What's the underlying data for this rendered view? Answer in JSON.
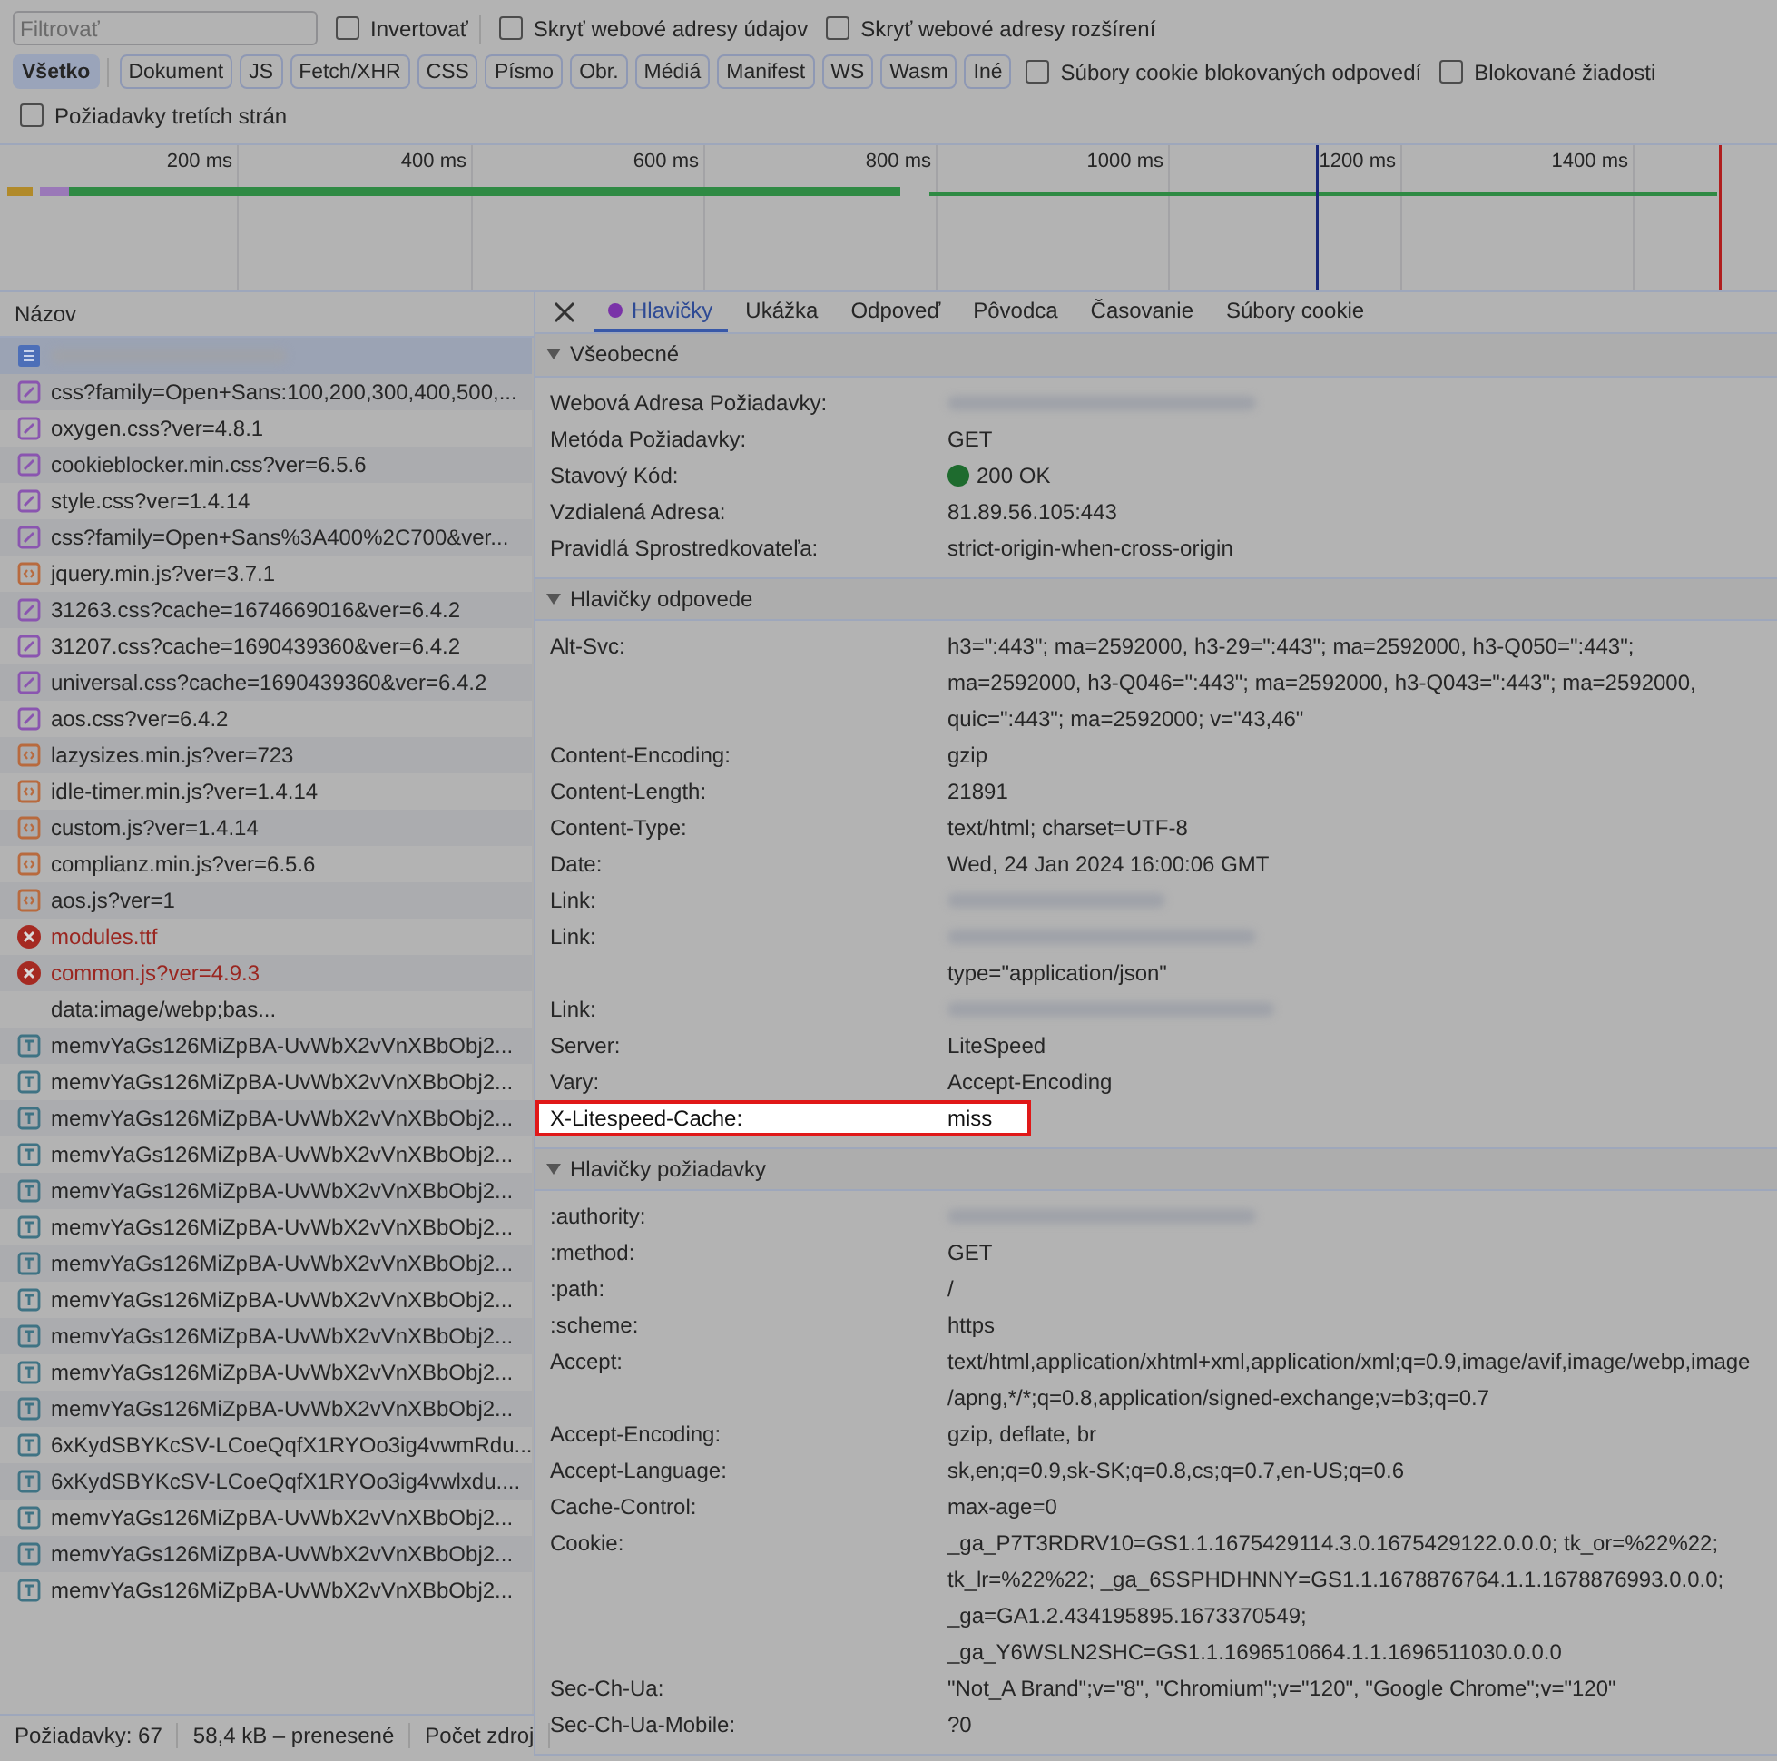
{
  "toolbar": {
    "filter": {
      "placeholder": "Filtrovať"
    },
    "checkboxes": [
      {
        "label": "Invertovať",
        "checked": false
      },
      {
        "label": "Skryť webové adresy údajov",
        "checked": false
      },
      {
        "label": "Skryť webové adresy rozšírení",
        "checked": false
      }
    ],
    "type_filters": [
      {
        "label": "Všetko",
        "selected": true
      },
      {
        "label": "Dokument",
        "selected": false
      },
      {
        "label": "JS",
        "selected": false
      },
      {
        "label": "Fetch/XHR",
        "selected": false
      },
      {
        "label": "CSS",
        "selected": false
      },
      {
        "label": "Písmo",
        "selected": false
      },
      {
        "label": "Obr.",
        "selected": false
      },
      {
        "label": "Médiá",
        "selected": false
      },
      {
        "label": "Manifest",
        "selected": false
      },
      {
        "label": "WS",
        "selected": false
      },
      {
        "label": "Wasm",
        "selected": false
      },
      {
        "label": "Iné",
        "selected": false
      }
    ],
    "filter_checkboxes": [
      {
        "label": "Súbory cookie blokovaných odpovedí",
        "checked": false
      },
      {
        "label": "Blokované žiadosti",
        "checked": false
      }
    ],
    "third_party": {
      "label": "Požiadavky tretích strán",
      "checked": false
    }
  },
  "timeline": {
    "ticks": [
      "200 ms",
      "400 ms",
      "600 ms",
      "800 ms",
      "1000 ms",
      "1200 ms",
      "1400 ms"
    ]
  },
  "requests": {
    "column": "Názov",
    "items": [
      {
        "kind": "doc",
        "selected": true
      },
      {
        "kind": "css",
        "name": "css?family=Open+Sans:100,200,300,400,500,...",
        "selected": false
      },
      {
        "kind": "css",
        "name": "oxygen.css?ver=4.8.1",
        "selected": false
      },
      {
        "kind": "css",
        "name": "cookieblocker.min.css?ver=6.5.6",
        "selected": false
      },
      {
        "kind": "css",
        "name": "style.css?ver=1.4.14",
        "selected": false
      },
      {
        "kind": "css",
        "name": "css?family=Open+Sans%3A400%2C700&ver...",
        "selected": false
      },
      {
        "kind": "js",
        "name": "jquery.min.js?ver=3.7.1",
        "selected": false
      },
      {
        "kind": "css",
        "name": "31263.css?cache=1674669016&ver=6.4.2",
        "selected": false
      },
      {
        "kind": "css",
        "name": "31207.css?cache=1690439360&ver=6.4.2",
        "selected": false
      },
      {
        "kind": "css",
        "name": "universal.css?cache=1690439360&ver=6.4.2",
        "selected": false
      },
      {
        "kind": "css",
        "name": "aos.css?ver=6.4.2",
        "selected": false
      },
      {
        "kind": "js",
        "name": "lazysizes.min.js?ver=723",
        "selected": false
      },
      {
        "kind": "js",
        "name": "idle-timer.min.js?ver=1.4.14",
        "selected": false
      },
      {
        "kind": "js",
        "name": "custom.js?ver=1.4.14",
        "selected": false
      },
      {
        "kind": "js",
        "name": "complianz.min.js?ver=6.5.6",
        "selected": false
      },
      {
        "kind": "js",
        "name": "aos.js?ver=1",
        "selected": false
      },
      {
        "kind": "error",
        "name": "modules.ttf",
        "selected": false
      },
      {
        "kind": "error",
        "name": "common.js?ver=4.9.3",
        "selected": false
      },
      {
        "kind": "data",
        "name": "data:image/webp;bas...",
        "selected": false
      },
      {
        "kind": "font",
        "name": "memvYaGs126MiZpBA-UvWbX2vVnXBbObj2...",
        "selected": false
      },
      {
        "kind": "font",
        "name": "memvYaGs126MiZpBA-UvWbX2vVnXBbObj2...",
        "selected": false
      },
      {
        "kind": "font",
        "name": "memvYaGs126MiZpBA-UvWbX2vVnXBbObj2...",
        "selected": false
      },
      {
        "kind": "font",
        "name": "memvYaGs126MiZpBA-UvWbX2vVnXBbObj2...",
        "selected": false
      },
      {
        "kind": "font",
        "name": "memvYaGs126MiZpBA-UvWbX2vVnXBbObj2...",
        "selected": false
      },
      {
        "kind": "font",
        "name": "memvYaGs126MiZpBA-UvWbX2vVnXBbObj2...",
        "selected": false
      },
      {
        "kind": "font",
        "name": "memvYaGs126MiZpBA-UvWbX2vVnXBbObj2...",
        "selected": false
      },
      {
        "kind": "font",
        "name": "memvYaGs126MiZpBA-UvWbX2vVnXBbObj2...",
        "selected": false
      },
      {
        "kind": "font",
        "name": "memvYaGs126MiZpBA-UvWbX2vVnXBbObj2...",
        "selected": false
      },
      {
        "kind": "font",
        "name": "memvYaGs126MiZpBA-UvWbX2vVnXBbObj2...",
        "selected": false
      },
      {
        "kind": "font",
        "name": "memvYaGs126MiZpBA-UvWbX2vVnXBbObj2...",
        "selected": false
      },
      {
        "kind": "font",
        "name": "6xKydSBYKcSV-LCoeQqfX1RYOo3ig4vwmRdu...",
        "selected": false
      },
      {
        "kind": "font",
        "name": "6xKydSBYKcSV-LCoeQqfX1RYOo3ig4vwlxdu....",
        "selected": false
      },
      {
        "kind": "font",
        "name": "memvYaGs126MiZpBA-UvWbX2vVnXBbObj2...",
        "selected": false
      },
      {
        "kind": "font",
        "name": "memvYaGs126MiZpBA-UvWbX2vVnXBbObj2...",
        "selected": false
      },
      {
        "kind": "font",
        "name": "memvYaGs126MiZpBA-UvWbX2vVnXBbObj2...",
        "selected": false
      }
    ]
  },
  "status_bar": [
    "Požiadavky: 67",
    "58,4 kB – prenesené",
    "Počet zdroj"
  ],
  "details": {
    "tabs": [
      {
        "label": "Hlavičky",
        "selected": true,
        "dot": true
      },
      {
        "label": "Ukážka",
        "selected": false,
        "dot": false
      },
      {
        "label": "Odpoveď",
        "selected": false,
        "dot": false
      },
      {
        "label": "Pôvodca",
        "selected": false,
        "dot": false
      },
      {
        "label": "Časovanie",
        "selected": false,
        "dot": false
      },
      {
        "label": "Súbory cookie",
        "selected": false,
        "dot": false
      }
    ],
    "sections": [
      {
        "title": "Všeobecné",
        "expanded": true,
        "rows": [
          {
            "name": "Webová Adresa Požiadavky:",
            "value_blurred": true,
            "highlighted": false
          },
          {
            "name": "Metóda Požiadavky:",
            "value_lines": [
              "GET"
            ],
            "highlighted": false
          },
          {
            "name": "Stavový Kód:",
            "value_lines": [
              "200 OK"
            ],
            "status_dot": true,
            "highlighted": false
          },
          {
            "name": "Vzdialená Adresa:",
            "value_lines": [
              "81.89.56.105:443"
            ],
            "highlighted": false
          },
          {
            "name": "Pravidlá Sprostredkovateľa:",
            "value_lines": [
              "strict-origin-when-cross-origin"
            ],
            "highlighted": false
          }
        ]
      },
      {
        "title": "Hlavičky odpovede",
        "expanded": true,
        "rows": [
          {
            "name": "Alt-Svc:",
            "value_lines": [
              "h3=\":443\"; ma=2592000, h3-29=\":443\"; ma=2592000, h3-Q050=\":443\";",
              "ma=2592000, h3-Q046=\":443\"; ma=2592000, h3-Q043=\":443\"; ma=2592000,",
              "quic=\":443\"; ma=2592000; v=\"43,46\""
            ],
            "highlighted": false
          },
          {
            "name": "Content-Encoding:",
            "value_lines": [
              "gzip"
            ],
            "highlighted": false
          },
          {
            "name": "Content-Length:",
            "value_lines": [
              "21891"
            ],
            "highlighted": false
          },
          {
            "name": "Content-Type:",
            "value_lines": [
              "text/html; charset=UTF-8"
            ],
            "highlighted": false
          },
          {
            "name": "Date:",
            "value_lines": [
              "Wed, 24 Jan 2024 16:00:06 GMT"
            ],
            "highlighted": false
          },
          {
            "name": "Link:",
            "value_blurred": true,
            "highlighted": false
          },
          {
            "name": "Link:",
            "value_blurred": true,
            "value_lines": [
              "type=\"application/json\""
            ],
            "highlighted": false
          },
          {
            "name": "Link:",
            "value_blurred": true,
            "highlighted": false
          },
          {
            "name": "Server:",
            "value_lines": [
              "LiteSpeed"
            ],
            "highlighted": false
          },
          {
            "name": "Vary:",
            "value_lines": [
              "Accept-Encoding"
            ],
            "highlighted": false
          },
          {
            "name": "X-Litespeed-Cache:",
            "value_lines": [
              "miss"
            ],
            "highlighted": true
          }
        ]
      },
      {
        "title": "Hlavičky požiadavky",
        "expanded": true,
        "rows": [
          {
            "name": ":authority:",
            "value_blurred": true,
            "highlighted": false
          },
          {
            "name": ":method:",
            "value_lines": [
              "GET"
            ],
            "highlighted": false
          },
          {
            "name": ":path:",
            "value_lines": [
              "/"
            ],
            "highlighted": false
          },
          {
            "name": ":scheme:",
            "value_lines": [
              "https"
            ],
            "highlighted": false
          },
          {
            "name": "Accept:",
            "value_lines": [
              "text/html,application/xhtml+xml,application/xml;q=0.9,image/avif,image/webp,image",
              "/apng,*/*;q=0.8,application/signed-exchange;v=b3;q=0.7"
            ],
            "highlighted": false
          },
          {
            "name": "Accept-Encoding:",
            "value_lines": [
              "gzip, deflate, br"
            ],
            "highlighted": false
          },
          {
            "name": "Accept-Language:",
            "value_lines": [
              "sk,en;q=0.9,sk-SK;q=0.8,cs;q=0.7,en-US;q=0.6"
            ],
            "highlighted": false
          },
          {
            "name": "Cache-Control:",
            "value_lines": [
              "max-age=0"
            ],
            "highlighted": false
          },
          {
            "name": "Cookie:",
            "value_lines": [
              "_ga_P7T3RDRV10=GS1.1.1675429114.3.0.1675429122.0.0.0; tk_or=%22%22;",
              "tk_lr=%22%22; _ga_6SSPHDHNNY=GS1.1.1678876764.1.1.1678876993.0.0.0;",
              "_ga=GA1.2.434195895.1673370549;",
              "_ga_Y6WSLN2SHC=GS1.1.1696510664.1.1.1696511030.0.0.0"
            ],
            "highlighted": false
          },
          {
            "name": "Sec-Ch-Ua:",
            "value_lines": [
              "\"Not_A Brand\";v=\"8\", \"Chromium\";v=\"120\", \"Google Chrome\";v=\"120\""
            ],
            "highlighted": false
          },
          {
            "name": "Sec-Ch-Ua-Mobile:",
            "value_lines": [
              "?0"
            ],
            "highlighted": false
          }
        ]
      }
    ]
  }
}
